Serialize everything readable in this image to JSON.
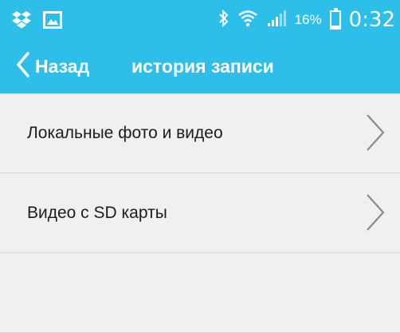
{
  "status_bar": {
    "icons_left": [
      "dropbox-icon",
      "image-icon"
    ],
    "icons_right": [
      "bluetooth-icon",
      "wifi-icon",
      "signal-icon",
      "battery-icon"
    ],
    "battery_text": "16%",
    "battery_level": 0.16,
    "time": "0:32"
  },
  "nav": {
    "back_label": "Назад",
    "title": "история записи"
  },
  "list": {
    "items": [
      {
        "label": "Локальные фото и видео"
      },
      {
        "label": "Видео с SD карты"
      },
      {
        "label": ""
      }
    ]
  },
  "colors": {
    "accent": "#2dbfe9",
    "background": "#f0f0f0",
    "divider": "#d6d6d6"
  }
}
